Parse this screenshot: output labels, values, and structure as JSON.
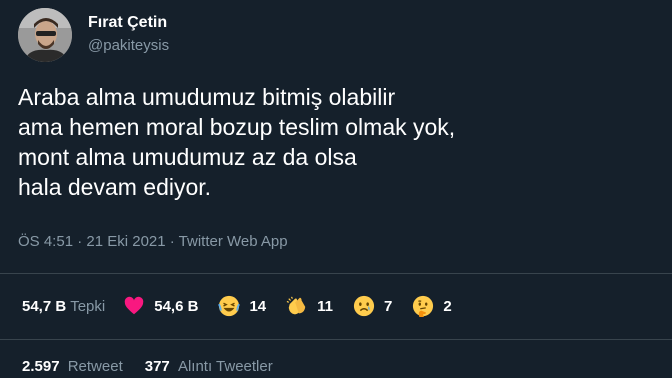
{
  "user": {
    "name": "Fırat Çetin",
    "handle": "@pakiteysis"
  },
  "tweet": {
    "lines": [
      "Araba alma umudumuz bitmiş olabilir",
      "ama hemen moral bozup teslim olmak yok,",
      "mont alma umudumuz az da olsa",
      "hala devam ediyor."
    ],
    "meta": "ÖS 4:51 · 21 Eki 2021 · Twitter Web App"
  },
  "reactions": {
    "total_count": "54,7 B",
    "total_label": "Tepki",
    "items": [
      {
        "icon": "heart-icon",
        "count": "54,6 B",
        "color": "#f91880"
      },
      {
        "icon": "laughing-face-icon",
        "count": "14",
        "color": "#ffcc4d"
      },
      {
        "icon": "clapping-hands-icon",
        "count": "11",
        "color": "#ffcc4d"
      },
      {
        "icon": "sad-face-icon",
        "count": "7",
        "color": "#ffcc4d"
      },
      {
        "icon": "thinking-face-icon",
        "count": "2",
        "color": "#ffcc4d"
      }
    ]
  },
  "stats": {
    "retweets_count": "2.597",
    "retweets_label": "Retweet",
    "quotes_count": "377",
    "quotes_label": "Alıntı Tweetler"
  },
  "colors": {
    "background": "#15202b",
    "secondary_text": "#8899a6",
    "divider": "#38444d"
  }
}
